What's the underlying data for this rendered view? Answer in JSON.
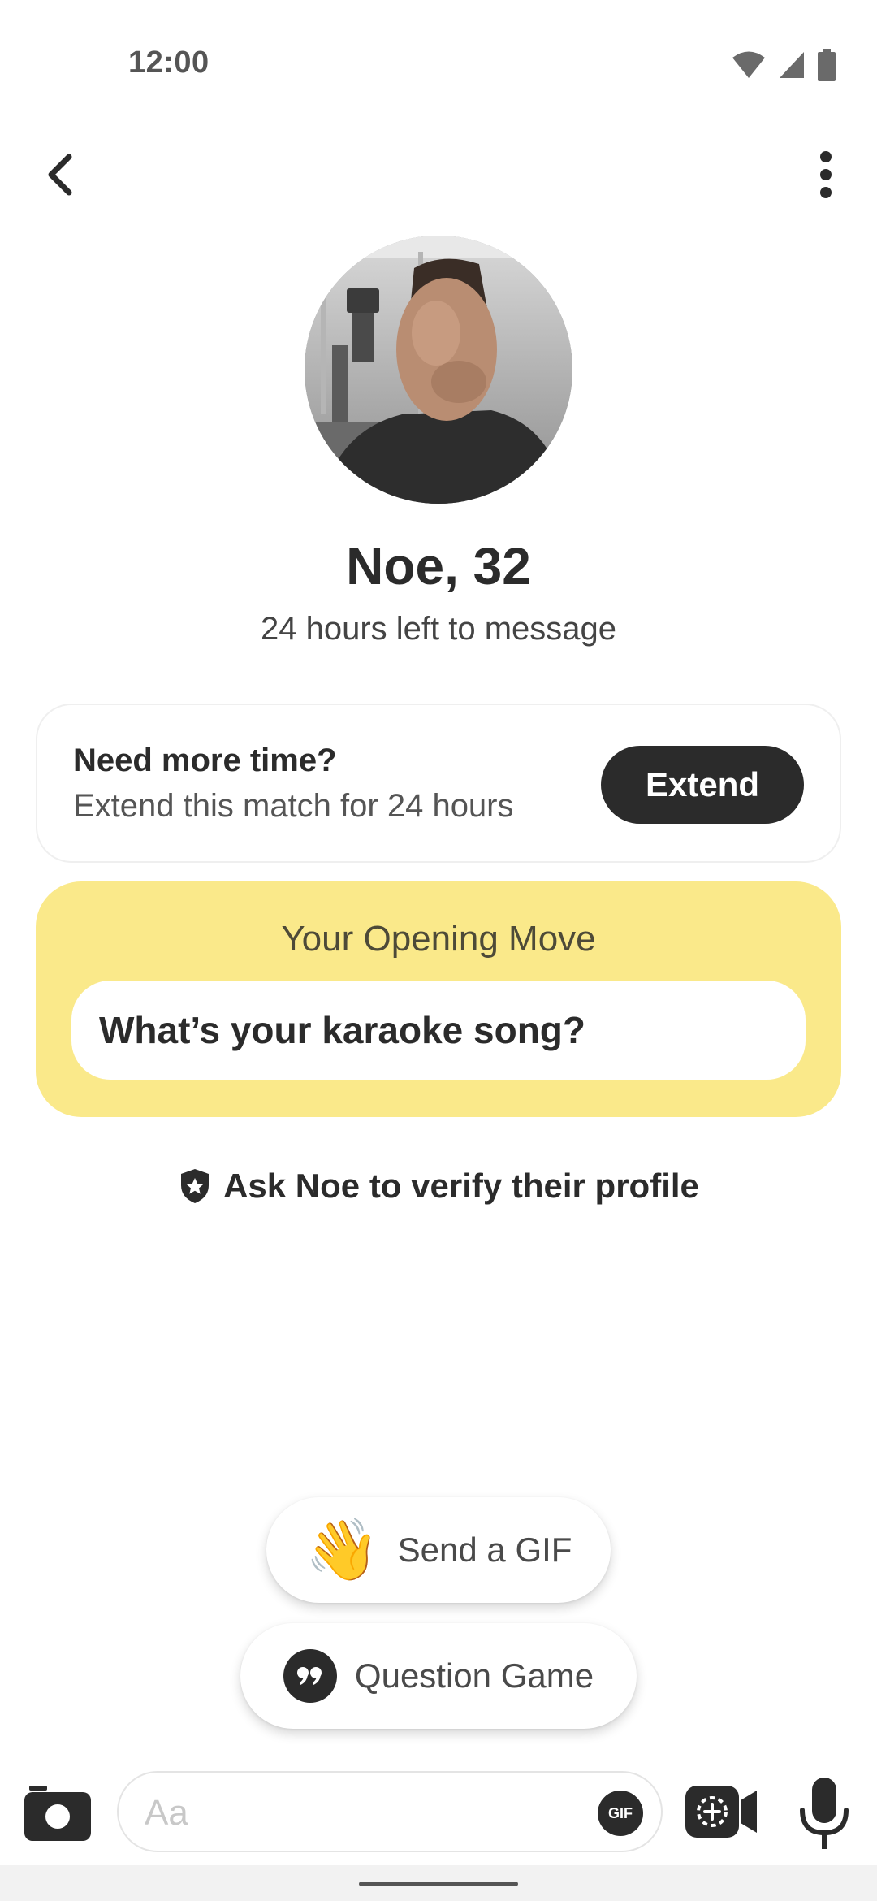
{
  "status_bar": {
    "time": "12:00",
    "icons": [
      "wifi-icon",
      "cellular-signal-icon",
      "battery-icon"
    ]
  },
  "top_bar": {
    "back_icon": "chevron-left-icon",
    "menu_icon": "more-vertical-icon"
  },
  "profile": {
    "name": "Noe, 32",
    "subtitle": "24 hours left to message"
  },
  "extend_card": {
    "title": "Need more time?",
    "subtitle": "Extend this match for 24 hours",
    "button_label": "Extend"
  },
  "opening_move": {
    "title": "Your Opening Move",
    "question": "What’s your karaoke song?",
    "color": "#fae98a"
  },
  "verify": {
    "icon": "shield-star-icon",
    "text": "Ask Noe to verify their profile"
  },
  "suggestions": {
    "gif_emoji": "👋",
    "gif_label": "Send a GIF",
    "question_icon": "quote-icon",
    "question_label": "Question Game"
  },
  "composer": {
    "camera_icon": "camera-icon",
    "placeholder": "Aa",
    "gif_badge": "GIF",
    "video_icon": "video-call-icon",
    "mic_icon": "microphone-icon"
  },
  "colors": {
    "dark": "#2b2b2b",
    "accent_yellow": "#fae98a"
  }
}
